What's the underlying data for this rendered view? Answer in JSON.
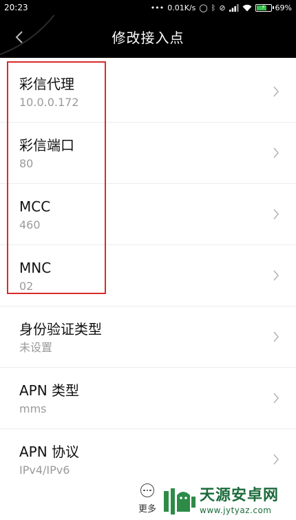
{
  "status_bar": {
    "time": "20:23",
    "network_speed": "0.01K/s",
    "battery_percent": "69%",
    "battery_level": 0.69,
    "icons": [
      "more-dots-icon",
      "data-saver-icon",
      "bluetooth-icon",
      "alarm-off-icon",
      "signal-icon",
      "wifi-icon",
      "battery-charging-icon"
    ]
  },
  "header": {
    "title": "修改接入点",
    "back_icon": "chevron-left-icon"
  },
  "settings": [
    {
      "title": "彩信代理",
      "value": "10.0.0.172"
    },
    {
      "title": "彩信端口",
      "value": "80"
    },
    {
      "title": "MCC",
      "value": "460"
    },
    {
      "title": "MNC",
      "value": "02"
    },
    {
      "title": "身份验证类型",
      "value": "未设置"
    },
    {
      "title": "APN 类型",
      "value": "mms"
    },
    {
      "title": "APN 协议",
      "value": "IPv4/IPv6"
    }
  ],
  "bottom_bar": {
    "more_label": "更多",
    "more_icon": "more-horizontal-icon"
  },
  "watermark": {
    "name": "天源安卓网",
    "url": "www.jytyaz.com"
  },
  "colors": {
    "highlight": "#d82a2a",
    "header_bg": "#000000",
    "watermark": "#1b6b3a"
  }
}
